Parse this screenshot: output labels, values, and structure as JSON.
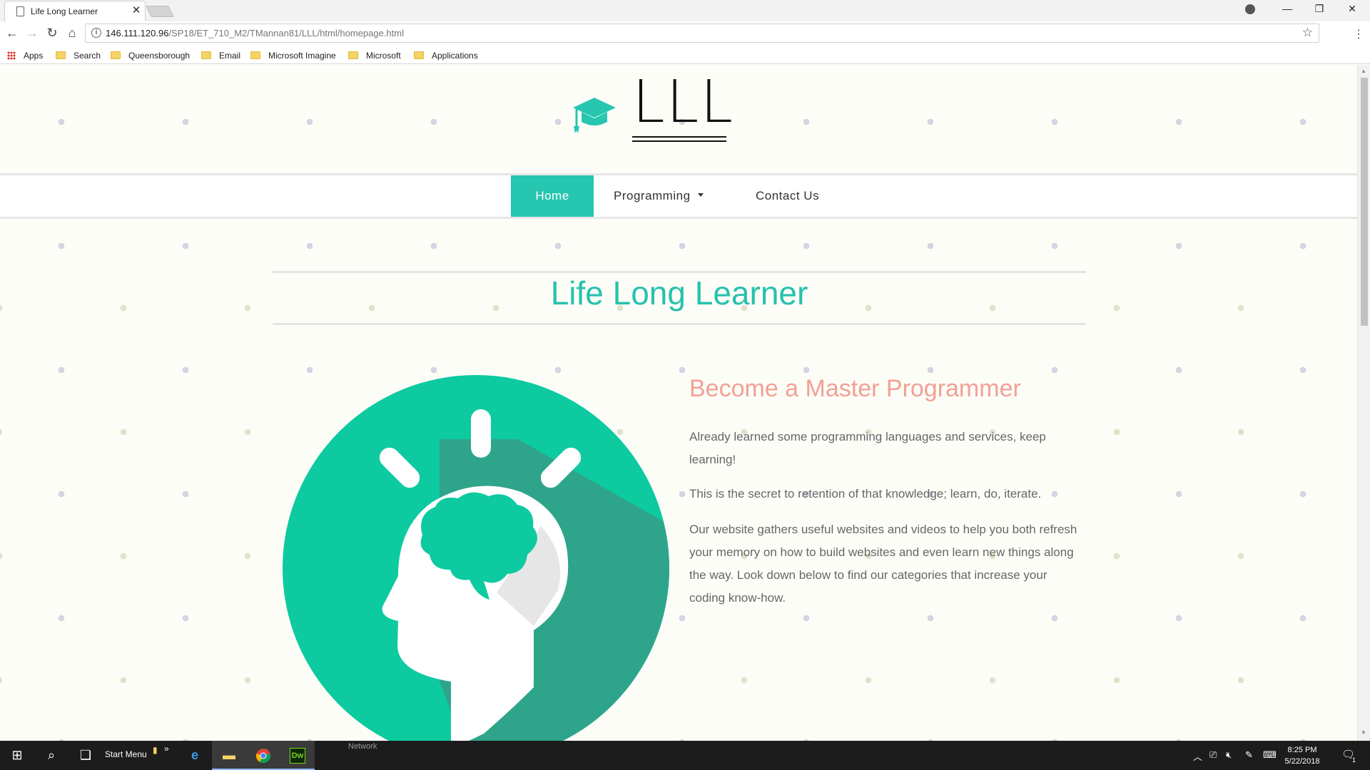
{
  "browser": {
    "tab_title": "Life Long Learner",
    "tab_close": "✕",
    "url_host": "146.111.120.96",
    "url_path": "/SP18/ET_710_M2/TMannan81/LLL/html/homepage.html",
    "bookmarks": [
      "Apps",
      "Search",
      "Queensborough",
      "Email",
      "Microsoft Imagine",
      "Microsoft",
      "Applications"
    ]
  },
  "site": {
    "logo_text": "LLL",
    "nav": [
      {
        "label": "Home",
        "active": true
      },
      {
        "label": "Programming",
        "has_dropdown": true
      },
      {
        "label": "Contact Us"
      }
    ],
    "heading": "Life Long Learner",
    "subheading": "Become a Master Programmer",
    "paragraphs": [
      "Already learned some programming languages and services, keep learning!",
      "This is the secret to retention of that knowledge; learn, do, iterate.",
      "Our website gathers useful websites and videos to help you both refresh your memory on how to build websites and even learn new things along the way. Look down below to find our categories that increase your coding know-how."
    ],
    "colors": {
      "accent": "#26c6b0",
      "heading": "#26c2ad",
      "subheading": "#f2a193",
      "background": "#fdfdf8"
    },
    "illustration_icon": "head-brain-idea-icon"
  },
  "taskbar": {
    "start_menu_label": "Start Menu",
    "network_label": "Network",
    "time": "8:25 PM",
    "date": "5/22/2018",
    "notification_count": "1",
    "pinned_apps": [
      "edge-icon",
      "file-explorer-icon",
      "chrome-icon",
      "dreamweaver-icon"
    ],
    "dreamweaver_label": "Dw"
  }
}
